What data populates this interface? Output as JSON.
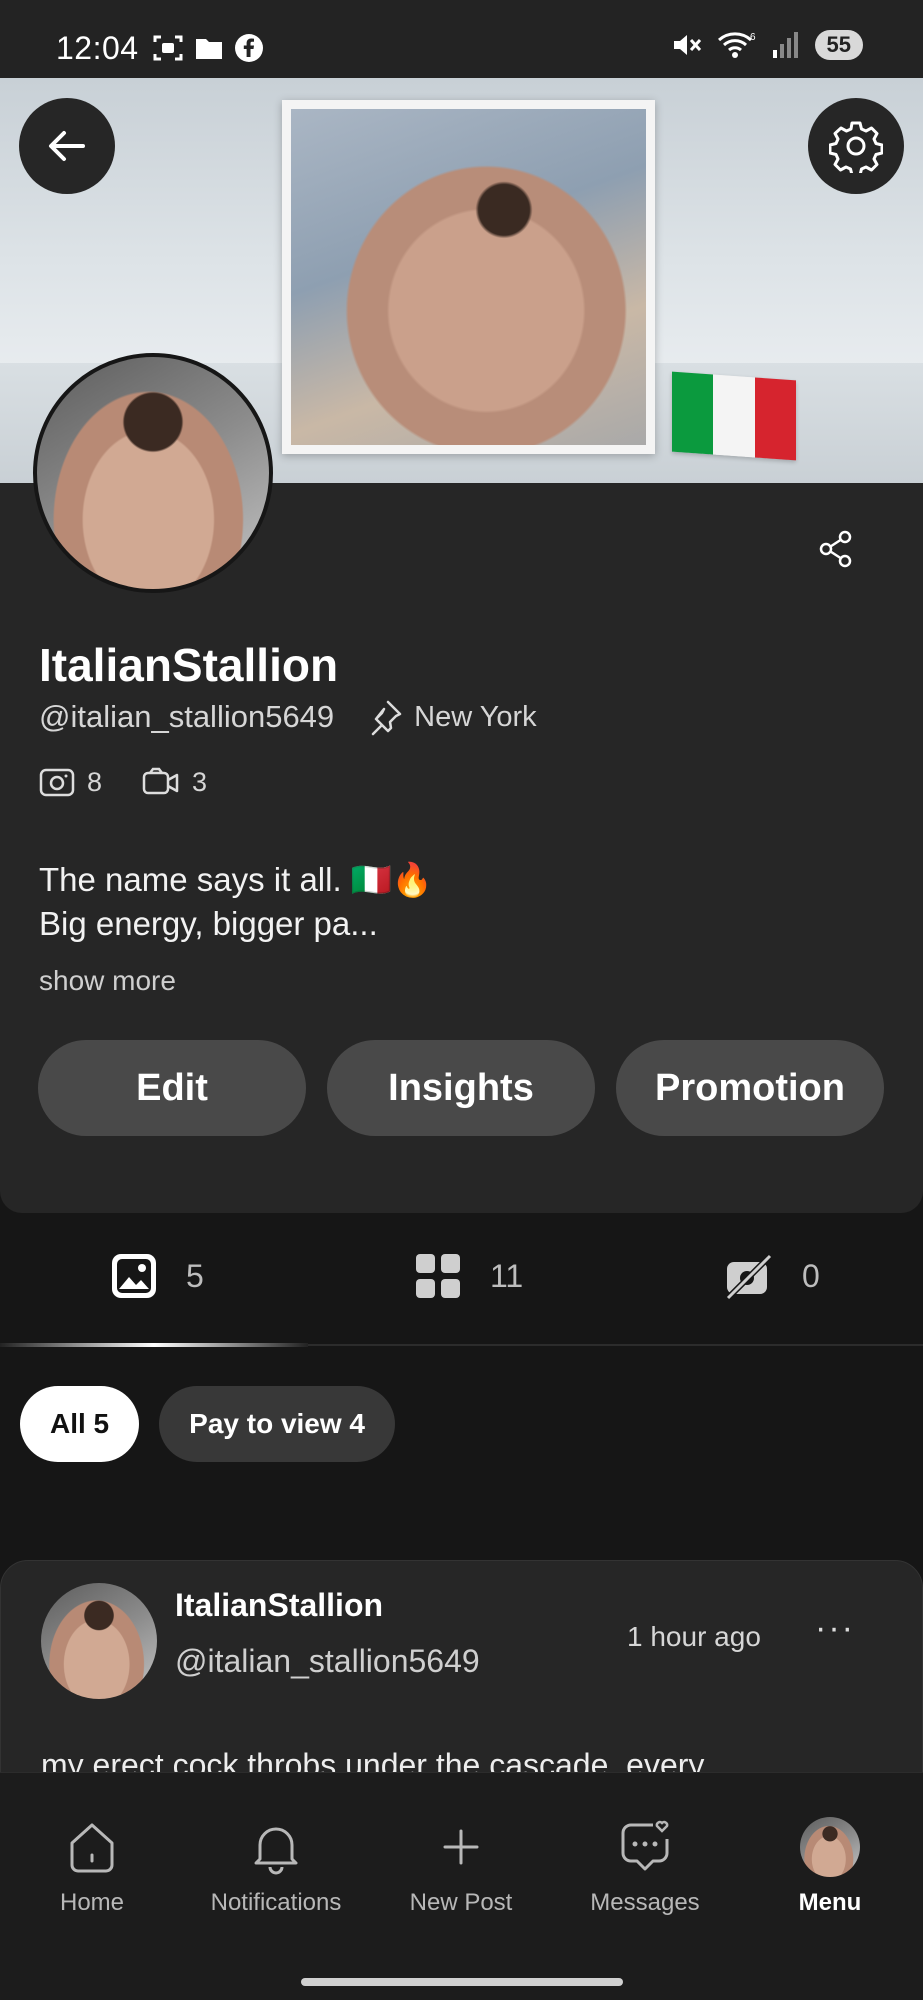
{
  "status_bar": {
    "time": "12:04",
    "left_icons": [
      "screenshot-icon",
      "folder-icon",
      "facebook-icon"
    ],
    "right_icons": [
      "mute-icon",
      "wifi-icon",
      "signal-icon"
    ],
    "battery": "55"
  },
  "banner": {
    "flag_colors": [
      "#0b9a3e",
      "#f4f4f4",
      "#d6242e"
    ]
  },
  "profile": {
    "display_name": "ItalianStallion",
    "handle": "@italian_stallion5649",
    "location": "New York",
    "photo_count": "8",
    "video_count": "3",
    "bio_line1": "The name says it all. 🇮🇹🔥",
    "bio_line2": "Big energy, bigger pa...",
    "show_more": "show more"
  },
  "actions": {
    "edit": "Edit",
    "insights": "Insights",
    "promotion": "Promotion"
  },
  "stats": {
    "photos": "5",
    "grid": "11",
    "locked": "0"
  },
  "filters": {
    "all": "All 5",
    "pay_to_view": "Pay to view 4"
  },
  "post": {
    "name": "ItalianStallion",
    "handle": "@italian_stallion5649",
    "time": "1 hour ago",
    "more": "···",
    "text": "my erect cock throbs under the cascade, every"
  },
  "nav": {
    "home": "Home",
    "notifications": "Notifications",
    "new_post": "New Post",
    "messages": "Messages",
    "menu": "Menu"
  },
  "colors": {
    "background": "#161616",
    "card": "#262626",
    "button": "#494949",
    "accent": "#ffffff"
  }
}
